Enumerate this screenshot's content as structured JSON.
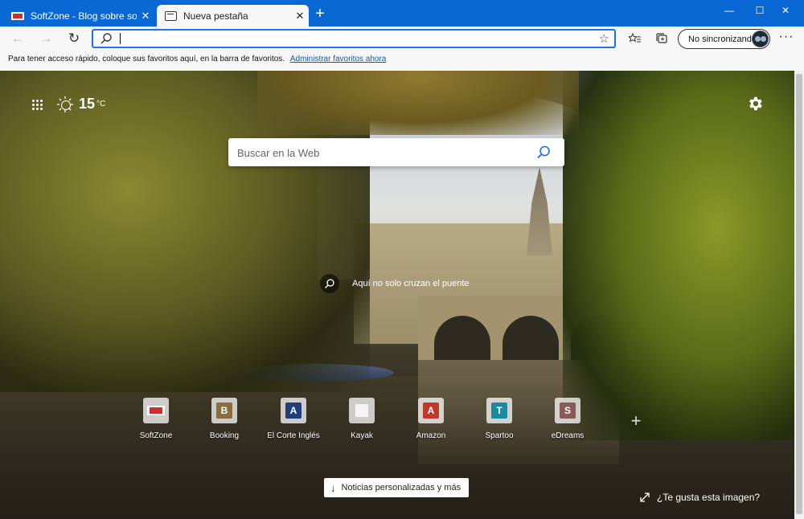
{
  "tabs": [
    {
      "label": "SoftZone - Blog sobre software,",
      "active": false
    },
    {
      "label": "Nueva pestaña",
      "active": true
    }
  ],
  "window_controls": {
    "minimize": "—",
    "maximize": "☐",
    "close": "✕"
  },
  "toolbar": {
    "back": "←",
    "forward": "→",
    "refresh": "↻",
    "address_value": "",
    "sync_label": "No sincronizando",
    "more": "···"
  },
  "favorites_bar": {
    "text": "Para tener acceso rápido, coloque sus favoritos aquí, en la barra de favoritos.",
    "link": "Administrar favoritos ahora"
  },
  "ntp": {
    "weather": {
      "temperature": "15",
      "unit": "°C",
      "icon": "sun-icon"
    },
    "search_placeholder": "Buscar en la Web",
    "image_caption": "Aquí no solo cruzan el puente",
    "quick_links": [
      {
        "label": "SoftZone",
        "icon": "softzone-logo"
      },
      {
        "label": "Booking",
        "letter": "B",
        "color": "#8a6d3b"
      },
      {
        "label": "El Corte Inglés",
        "letter": "A",
        "color": "#1f3f7a"
      },
      {
        "label": "Kayak",
        "icon": "broken-image"
      },
      {
        "label": "Amazon",
        "letter": "A",
        "color": "#c0392b"
      },
      {
        "label": "Spartoo",
        "letter": "T",
        "color": "#1a8aa0"
      },
      {
        "label": "eDreams",
        "letter": "S",
        "color": "#8a5a5a"
      }
    ],
    "add_link": "+",
    "news_button": "Noticias personalizadas y más",
    "like_image": "¿Te gusta esta imagen?"
  },
  "colors": {
    "tabbar": "#0a68d4",
    "accent": "#1a73e8"
  }
}
